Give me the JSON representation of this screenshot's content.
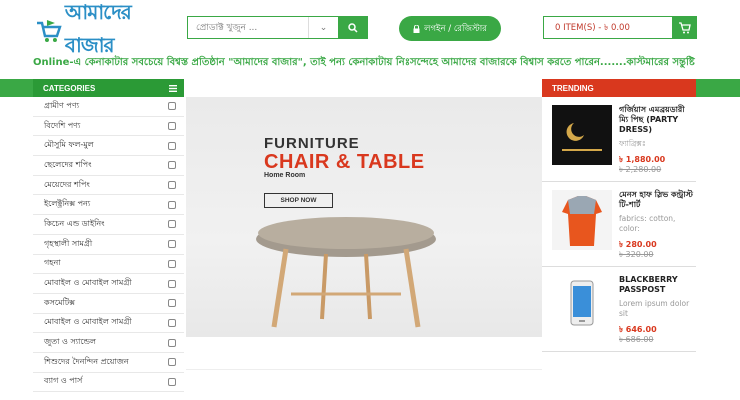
{
  "header": {
    "logo_text": "আমাদের বাজার",
    "search_placeholder": "প্রোডাক্ট খুজুন ...",
    "login_label": "লগইন / রেজিস্টার",
    "cart_label": "0 ITEM(S) - ৳ 0.00"
  },
  "marquee": {
    "text": "Online-এ কেনাকাটার সবচেয়ে বিশ্বস্ত প্রতিষ্ঠান \"আমাদের বাজার\", তাই পন্য কেনাকাটায় নিঃসন্দেহে আমাদের বাজারকে বিশ্বাস করতে পারেন.......কাস্টমারের সন্তুষ্টি"
  },
  "categories": {
    "title": "CATEGORIES",
    "items": [
      "গ্রামীণ পণ্য",
      "বিদেশি পণ্য",
      "মৌসুমি ফল-মুল",
      "ছেলেদের শপিং",
      "মেয়েদের শপিং",
      "ইলেক্ট্রনিক্স পন্য",
      "কিচেন এন্ড ডাইনিং",
      "গৃহস্থালী সামগ্রী",
      "গহনা",
      "মোবাইল ও মোবাইল সামগ্রী",
      "কসমেটিক্স",
      "মোবাইল ও মোবাইল সামগ্রী",
      "জুতা ও স্যান্ডেল",
      "শিশুদের দৈনন্দিন প্রয়োজন",
      "ব্যাগ ও পার্স"
    ]
  },
  "banner": {
    "line1": "FURNITURE",
    "line2": "CHAIR & TABLE",
    "line3": "Home Room",
    "button": "SHOP NOW"
  },
  "trending": {
    "title": "TRENDING",
    "items": [
      {
        "name": "গর্জিয়াস এমব্রয়ডারী ম্যি পিছ (PARTY DRESS)",
        "desc": "ফ্যাব্রিক্সঃ",
        "price": "৳ 1,880.00",
        "old_price": "৳ 2,280.00"
      },
      {
        "name": "মেনস হাফ স্লিভ কন্ট্রাস্ট টি-শার্ট",
        "desc": "fabrics: cotton, color:",
        "price": "৳ 280.00",
        "old_price": "৳ 320.00"
      },
      {
        "name": "BLACKBERRY PASSPOST",
        "desc": "Lorem ipsum dolor sit",
        "price": "৳ 646.00",
        "old_price": "৳ 686.00"
      }
    ]
  },
  "colors": {
    "primary": "#3aa845",
    "accent": "#d9381e",
    "brand_blue": "#2b8fc6"
  }
}
